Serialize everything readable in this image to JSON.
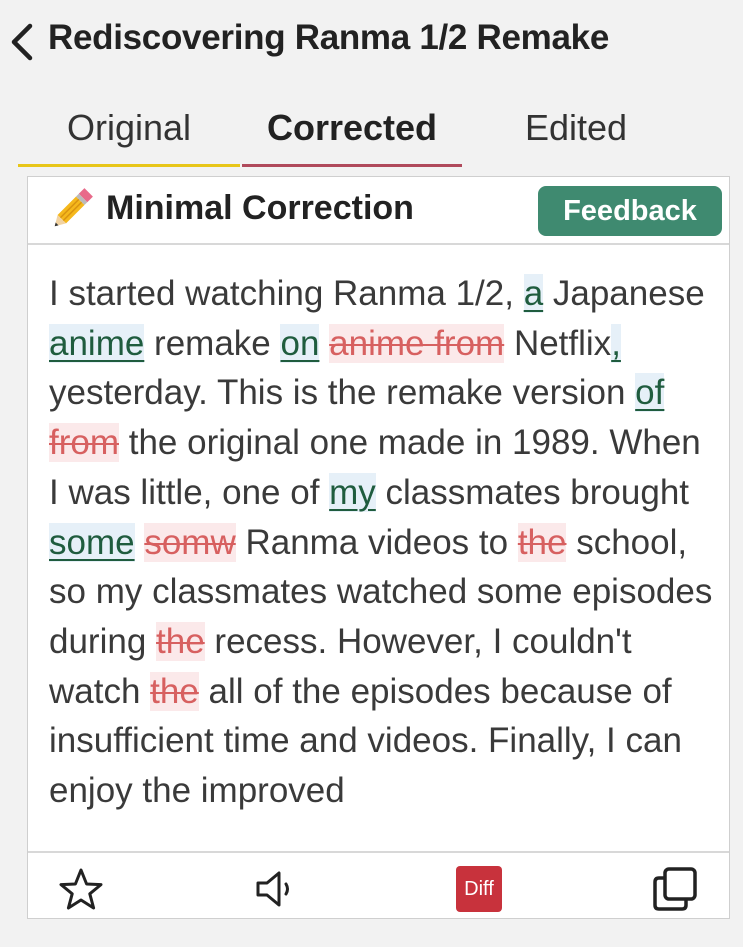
{
  "header": {
    "title": "Rediscovering Ranma 1/2 Remake"
  },
  "tabs": [
    {
      "label": "Original"
    },
    {
      "label": "Corrected"
    },
    {
      "label": "Edited"
    }
  ],
  "tab_colors": {
    "original_underline": "#e8c619",
    "corrected_underline": "#b04a5c"
  },
  "card": {
    "title": "Minimal Correction",
    "feedback_label": "Feedback",
    "feedback_color": "#3f8a70"
  },
  "correction": {
    "added_color": "#1f5c3e",
    "added_bg": "#e6f0f8",
    "deleted_color": "#d76060",
    "deleted_bg": "#fbe9ea",
    "segments": [
      {
        "t": "text",
        "v": "I started watching Ranma 1/2, "
      },
      {
        "t": "add",
        "v": "a"
      },
      {
        "t": "text",
        "v": " Japanese "
      },
      {
        "t": "add",
        "v": "anime"
      },
      {
        "t": "text",
        "v": " remake "
      },
      {
        "t": "add",
        "v": "on"
      },
      {
        "t": "text",
        "v": " "
      },
      {
        "t": "del",
        "v": "anime from"
      },
      {
        "t": "text",
        "v": " Netflix"
      },
      {
        "t": "add",
        "v": ","
      },
      {
        "t": "text",
        "v": " yesterday. This is the remake version "
      },
      {
        "t": "add",
        "v": "of"
      },
      {
        "t": "text",
        "v": " "
      },
      {
        "t": "del",
        "v": "from"
      },
      {
        "t": "text",
        "v": " the original one made in 1989. When I was little, one of "
      },
      {
        "t": "add",
        "v": "my"
      },
      {
        "t": "text",
        "v": " classmates brought "
      },
      {
        "t": "add",
        "v": "some"
      },
      {
        "t": "text",
        "v": " "
      },
      {
        "t": "del",
        "v": "somw"
      },
      {
        "t": "text",
        "v": " Ranma videos to "
      },
      {
        "t": "del",
        "v": "the"
      },
      {
        "t": "text",
        "v": " school, so my classmates watched some episodes during "
      },
      {
        "t": "del",
        "v": "the"
      },
      {
        "t": "text",
        "v": " recess. However, I couldn't watch "
      },
      {
        "t": "del",
        "v": "the"
      },
      {
        "t": "text",
        "v": " all of the episodes because of insufficient time and videos. Finally, I can enjoy the improved"
      }
    ]
  },
  "bottom_bar": {
    "star_icon": "star-outline-icon",
    "speaker_icon": "speaker-icon",
    "diff_label": "Diff",
    "diff_color": "#c8323c",
    "copy_icon": "copy-icon"
  }
}
